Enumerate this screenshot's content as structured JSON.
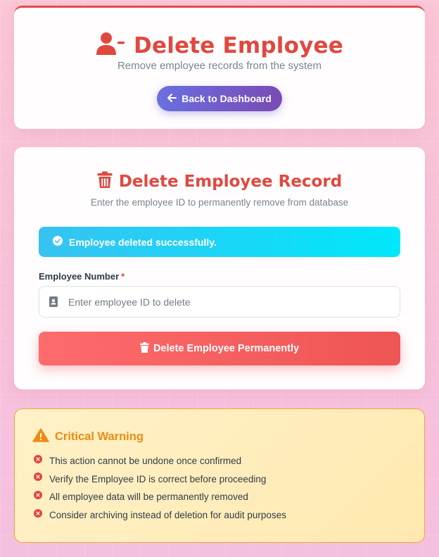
{
  "header": {
    "title": "Delete Employee",
    "subtitle": "Remove employee records from the system",
    "back_button_label": "Back to Dashboard",
    "icon": "user-minus-icon"
  },
  "form": {
    "title": "Delete Employee Record",
    "subtitle": "Enter the employee ID to permanently remove from database",
    "icon": "trash-icon",
    "alert": {
      "message": "Employee deleted successfully.",
      "icon": "check-circle-icon"
    },
    "field": {
      "label": "Employee Number",
      "required_mark": "*",
      "placeholder": "Enter employee ID to delete",
      "value": "",
      "icon": "id-badge-icon"
    },
    "submit_label": "Delete Employee Permanently"
  },
  "warning": {
    "title": "Critical Warning",
    "icon": "warning-triangle-icon",
    "items": [
      "This action cannot be undone once confirmed",
      "Verify the Employee ID is correct before proceeding",
      "All employee data will be permanently removed",
      "Consider archiving instead of deletion for audit purposes"
    ]
  },
  "colors": {
    "accent_red": "#e0483f",
    "warning_orange": "#f08a12",
    "success_cyan": "#00e8fb",
    "back_button_purple": "#6a6fe0"
  }
}
